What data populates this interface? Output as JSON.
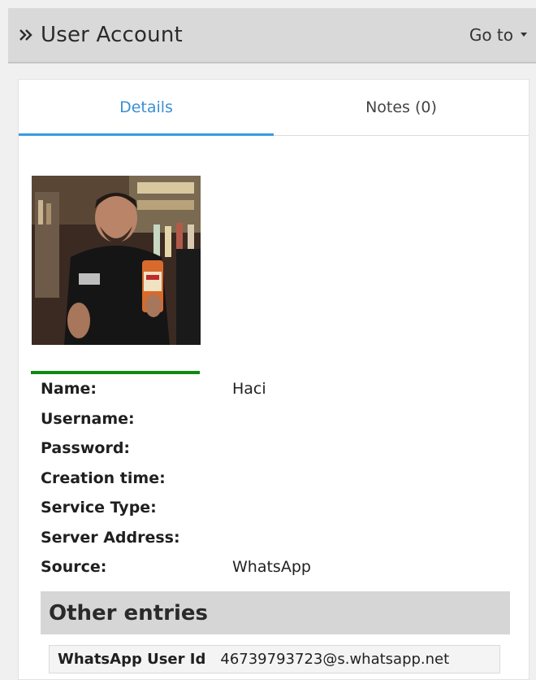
{
  "header": {
    "title": "User Account",
    "goto_label": "Go to"
  },
  "tabs": [
    {
      "label": "Details",
      "active": true
    },
    {
      "label": "Notes (0)",
      "active": false
    }
  ],
  "details": [
    {
      "label": "Name:",
      "value": "Haci"
    },
    {
      "label": "Username:",
      "value": ""
    },
    {
      "label": "Password:",
      "value": ""
    },
    {
      "label": "Creation time:",
      "value": ""
    },
    {
      "label": "Service Type:",
      "value": ""
    },
    {
      "label": "Server Address:",
      "value": ""
    },
    {
      "label": "Source:",
      "value": "WhatsApp"
    }
  ],
  "other_entries": {
    "title": "Other entries",
    "items": [
      {
        "key": "WhatsApp User Id",
        "value": "46739793723@s.whatsapp.net"
      }
    ]
  },
  "colors": {
    "accent": "#3a8fd6",
    "avatar_status": "#0d8a12"
  },
  "icons": {
    "expand": "double-chevron-right-icon",
    "goto": "caret-down-icon"
  }
}
